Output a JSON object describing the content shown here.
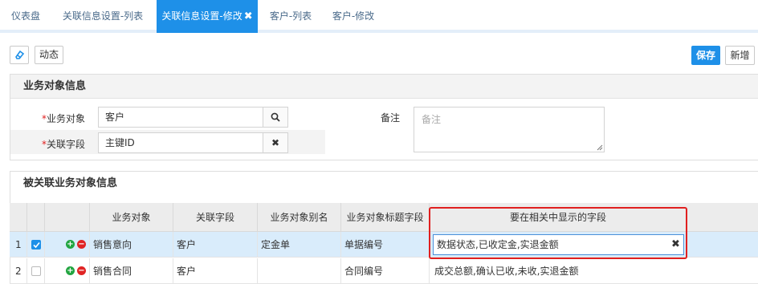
{
  "tabs": [
    {
      "label": "仪表盘"
    },
    {
      "label": "关联信息设置-列表"
    },
    {
      "label": "关联信息设置-修改",
      "active": true
    },
    {
      "label": "客户-列表"
    },
    {
      "label": "客户-修改"
    }
  ],
  "toolbar": {
    "icon_button": "eraser-icon",
    "dynamic_label": "动态",
    "save_label": "保存",
    "new_label": "新增"
  },
  "business_section": {
    "title": "业务对象信息",
    "fields": {
      "object": {
        "label": "业务对象",
        "value": "客户",
        "required": "*",
        "addon_icon": "search-icon"
      },
      "link_field": {
        "label": "关联字段",
        "value": "主键ID",
        "required": "*",
        "addon_icon": "clear-icon"
      },
      "remark": {
        "label": "备注",
        "placeholder": "备注",
        "value": ""
      }
    }
  },
  "linked_section": {
    "title": "被关联业务对象信息",
    "columns": [
      "业务对象",
      "关联字段",
      "业务对象别名",
      "业务对象标题字段",
      "要在相关中显示的字段"
    ],
    "rows": [
      {
        "index": "1",
        "checked": true,
        "object": "销售意向",
        "field": "客户",
        "alias": "定金单",
        "title_field": "单据编号",
        "display_fields": "数据状态,已收定金,实退金额"
      },
      {
        "index": "2",
        "checked": false,
        "object": "销售合同",
        "field": "客户",
        "alias": "",
        "title_field": "合同编号",
        "display_fields": "成交总额,确认已收,未收,实退金额"
      }
    ]
  },
  "colors": {
    "accent": "#1e90e8",
    "highlight_border": "#e02020",
    "row_selected": "#d9ecfb"
  }
}
